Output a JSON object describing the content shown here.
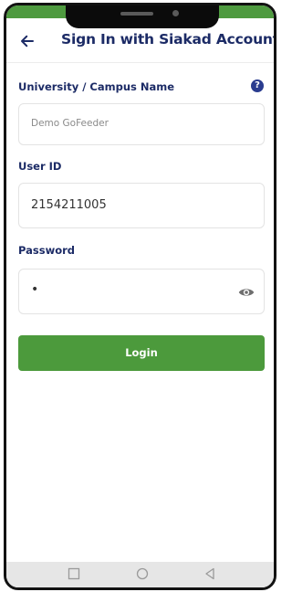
{
  "header": {
    "title": "Sign In with Siakad Account"
  },
  "form": {
    "university": {
      "label": "University / Campus Name",
      "placeholder": "Demo GoFeeder"
    },
    "user_id": {
      "label": "User ID",
      "value": "2154211005"
    },
    "password": {
      "label": "Password",
      "value": "•"
    },
    "login_label": "Login"
  },
  "colors": {
    "primary_green": "#4c9a3c",
    "title_navy": "#1c2b66"
  },
  "icons": {
    "back": "arrow-left-icon",
    "help": "question-circle-icon",
    "visibility": "eye-icon",
    "nav_recents": "square-icon",
    "nav_home": "circle-icon",
    "nav_back": "triangle-icon"
  }
}
